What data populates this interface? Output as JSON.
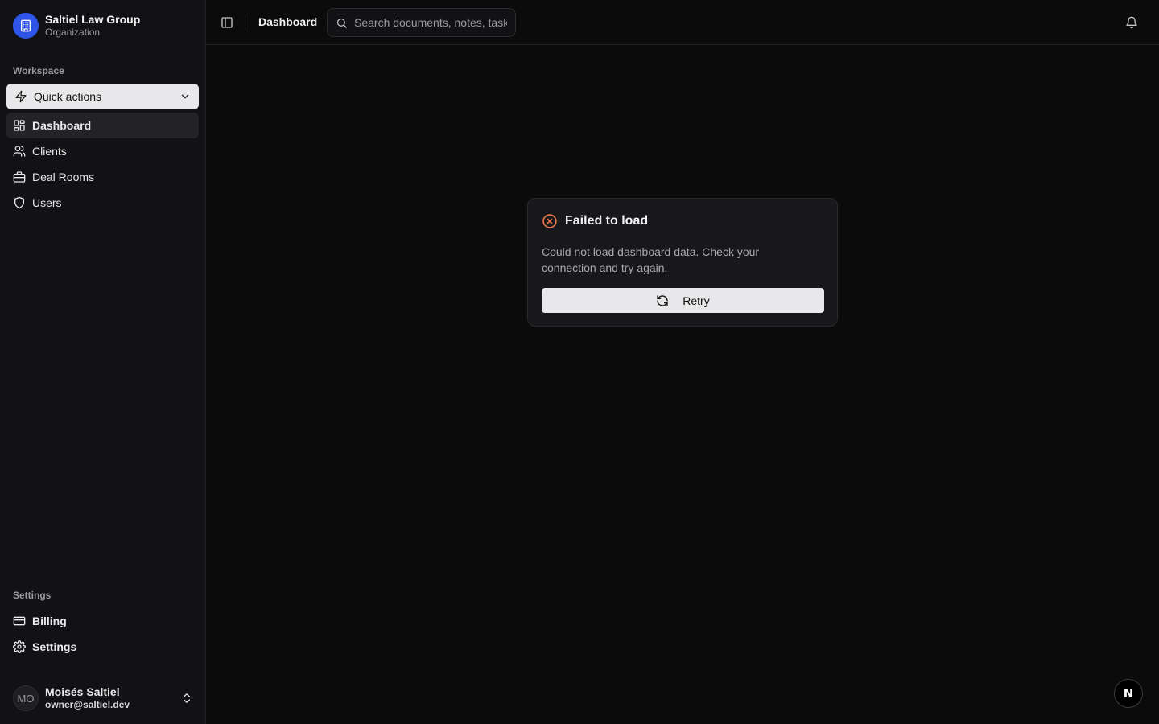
{
  "org": {
    "name": "Saltiel Law Group",
    "type": "Organization",
    "logo_icon": "building-icon",
    "logo_color": "#2f55e8"
  },
  "sidebar": {
    "workspace_label": "Workspace",
    "quick_actions": {
      "label": "Quick actions",
      "icon": "zap-icon"
    },
    "items": [
      {
        "label": "Dashboard",
        "icon": "layout-grid-icon",
        "active": true
      },
      {
        "label": "Clients",
        "icon": "users-icon",
        "active": false
      },
      {
        "label": "Deal Rooms",
        "icon": "briefcase-icon",
        "active": false
      },
      {
        "label": "Users",
        "icon": "shield-icon",
        "active": false
      }
    ],
    "settings_label": "Settings",
    "settings_items": [
      {
        "label": "Billing",
        "icon": "credit-card-icon"
      },
      {
        "label": "Settings",
        "icon": "gear-icon"
      }
    ]
  },
  "user": {
    "initials": "MO",
    "name": "Moisés Saltiel",
    "email": "owner@saltiel.dev"
  },
  "topbar": {
    "breadcrumb": "Dashboard",
    "search_placeholder": "Search documents, notes, tasks..."
  },
  "error_card": {
    "title": "Failed to load",
    "message": "Could not load dashboard data. Check your connection and try again.",
    "retry_label": "Retry",
    "accent": "#e8744a"
  },
  "fab": {
    "label": "N"
  }
}
